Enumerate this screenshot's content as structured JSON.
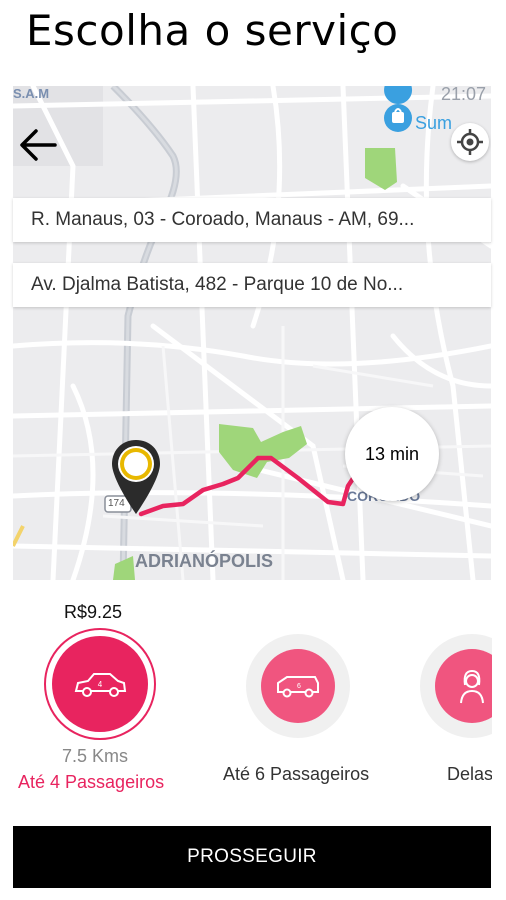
{
  "page": {
    "title": "Escolha o serviço"
  },
  "map": {
    "label_sumauma": "Sum",
    "label_time": "21:07",
    "label_top_left": "S.A.M",
    "label_coroado": "COROADO",
    "label_adrianopolis": "ADRIANÓPOLIS",
    "label_road": "174",
    "eta": "13 min",
    "route_color": "#e8245f",
    "pin_color": "#e8b800"
  },
  "addresses": {
    "origin": "R. Manaus, 03 - Coroado, Manaus - AM, 69...",
    "destination": "Av. Djalma Batista, 482 - Parque 10 de No..."
  },
  "services": {
    "selected_price": "R$9.25",
    "selected_distance": "7.5 Kms",
    "items": [
      {
        "label": "Até 4 Passageiros",
        "icon": "car-icon",
        "selected": true
      },
      {
        "label": "Até 6 Passageiros",
        "icon": "van-icon",
        "selected": false
      },
      {
        "label": "Delas",
        "icon": "woman-icon",
        "selected": false
      }
    ],
    "accent_color": "#e8245f"
  },
  "footer": {
    "cta_label": "PROSSEGUIR"
  }
}
